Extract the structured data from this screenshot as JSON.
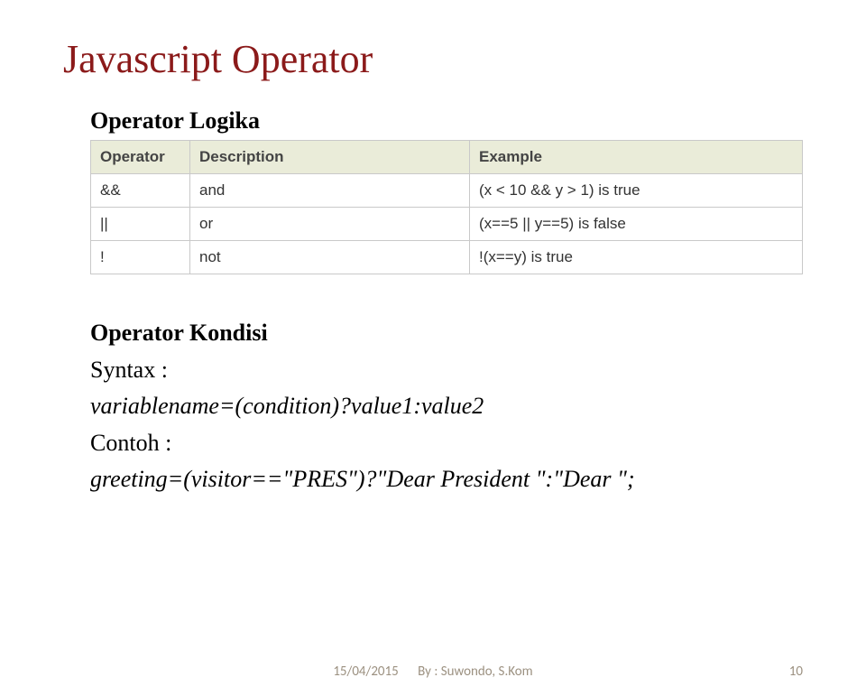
{
  "title": "Javascript Operator",
  "section1": {
    "heading": "Operator Logika",
    "table": {
      "headers": [
        "Operator",
        "Description",
        "Example"
      ],
      "rows": [
        {
          "op": "&&",
          "desc": "and",
          "ex": "(x < 10 && y > 1) is true"
        },
        {
          "op": "||",
          "desc": "or",
          "ex": "(x==5 || y==5) is false"
        },
        {
          "op": "!",
          "desc": "not",
          "ex": "!(x==y) is true"
        }
      ]
    }
  },
  "section2": {
    "heading": "Operator Kondisi",
    "syntax_label": "Syntax :",
    "syntax_code": "variablename=(condition)?value1:value2",
    "example_label": "Contoh :",
    "example_code": "greeting=(visitor==\"PRES\")?\"Dear President \":\"Dear \";"
  },
  "footer": {
    "date": "15/04/2015",
    "author": "By : Suwondo, S.Kom",
    "page": "10"
  }
}
